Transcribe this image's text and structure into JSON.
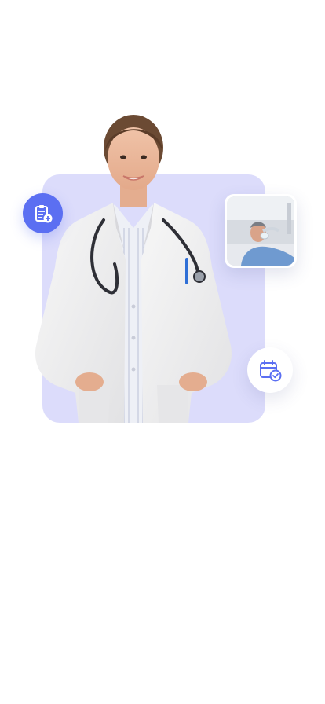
{
  "screen": {
    "name": "doctor-hero-illustration"
  },
  "colors": {
    "accent": "#5b6ff2",
    "backdrop": "#dcdcfb",
    "background": "#ffffff"
  },
  "icons": {
    "clipboard_badge": "clipboard-plus-icon",
    "calendar_badge": "calendar-check-icon"
  }
}
